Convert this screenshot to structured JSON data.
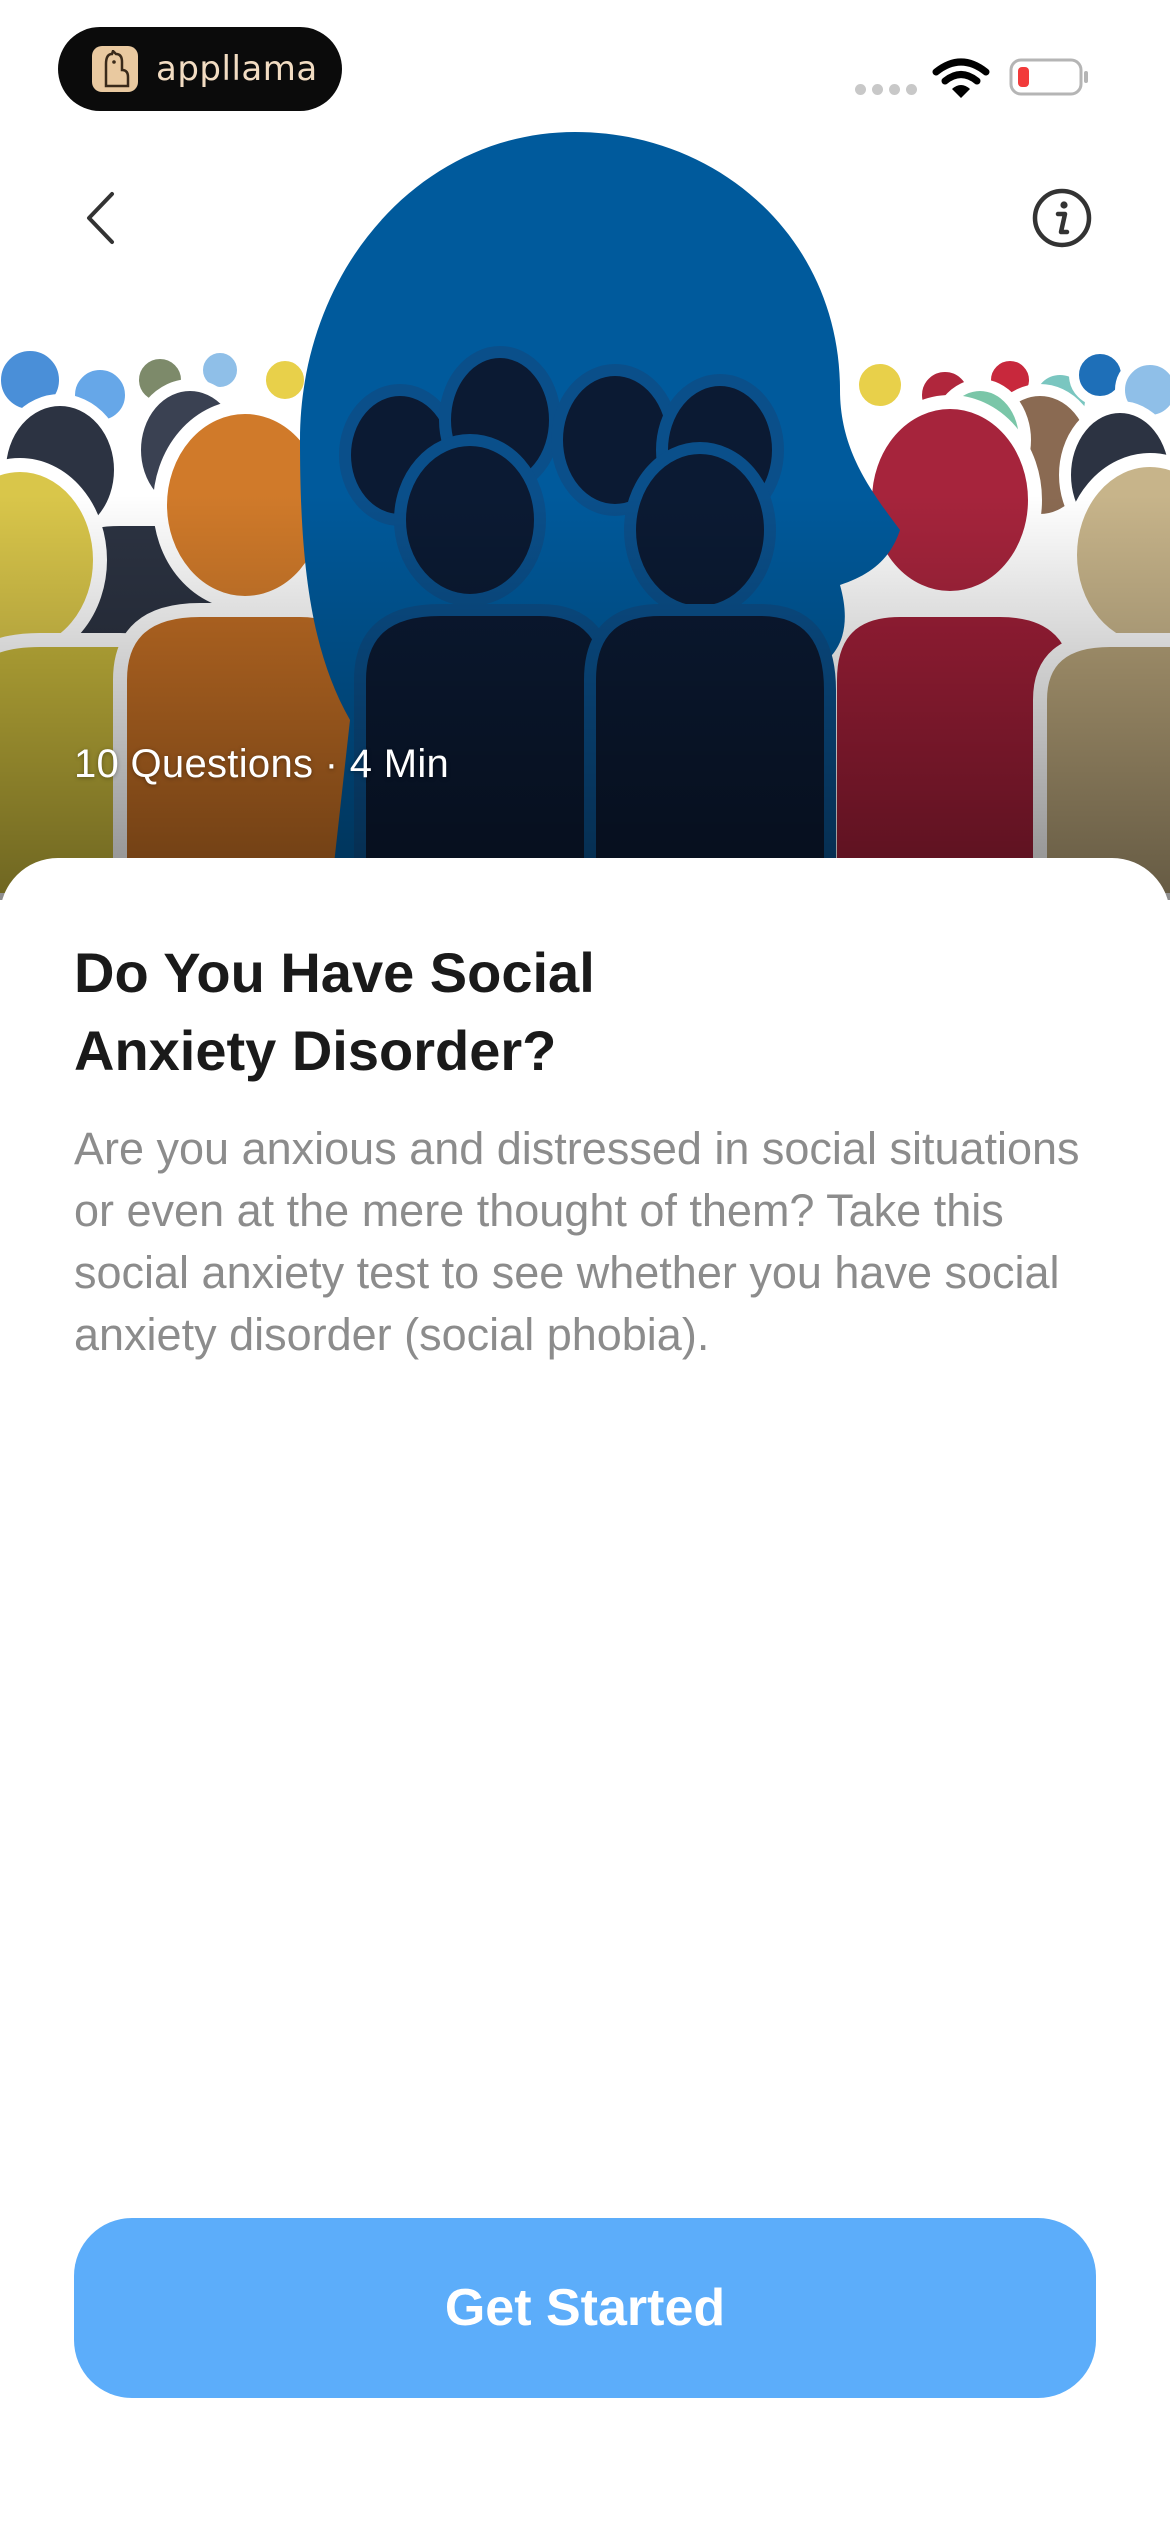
{
  "status_bar": {
    "brand": "appllama",
    "brand_logo_icon": "llama-logo-icon",
    "wifi_icon": "wifi-icon",
    "battery_icon": "battery-low-icon",
    "battery_color": "#f23b3b"
  },
  "nav": {
    "back_icon": "chevron-left-icon",
    "info_icon": "info-circle-icon"
  },
  "hero": {
    "meta": "10 Questions · 4 Min"
  },
  "quiz": {
    "title_line1": "Do You Have Social",
    "title_line2": "Anxiety Disorder?",
    "description": "Are you anxious and distressed in social situations or even at the mere thought of them? Take this social anxiety test to see whether you have social anxiety disorder (social phobia)."
  },
  "cta": {
    "label": "Get Started",
    "color": "#5cadfa"
  },
  "colors": {
    "silhouette_blue": "#005a9c",
    "title": "#1a1a1a",
    "body": "#8c8c8c"
  }
}
